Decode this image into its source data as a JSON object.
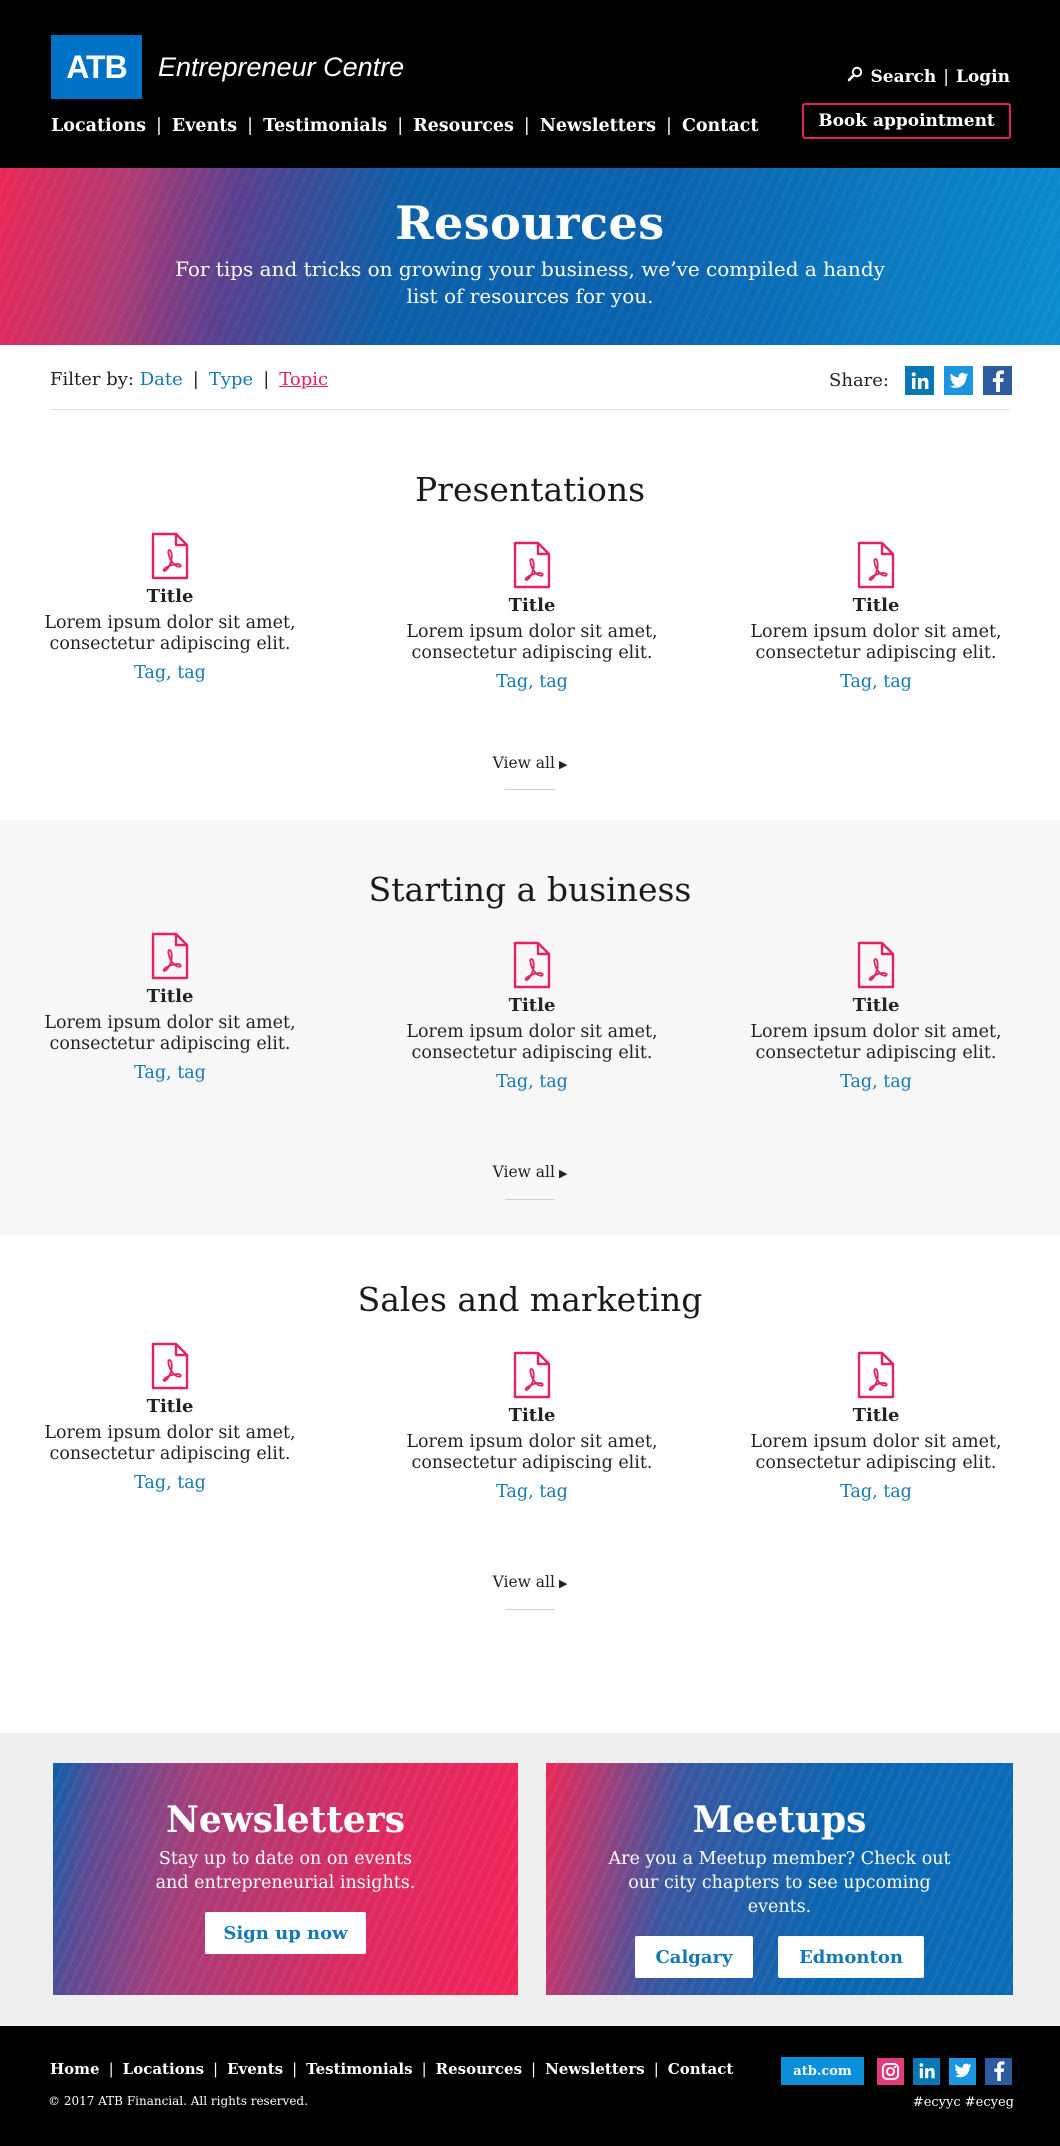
{
  "header": {
    "logo": "ATB",
    "brand": "Entrepreneur Centre",
    "utility": {
      "search": "Search",
      "login": "Login"
    },
    "nav": [
      "Locations",
      "Events",
      "Testimonials",
      "Resources",
      "Newsletters",
      "Contact"
    ],
    "book_button": "Book appointment"
  },
  "hero": {
    "title": "Resources",
    "subtitle": "For tips and tricks on growing your business, we’ve compiled a handy list of resources for you."
  },
  "filter": {
    "label": "Filter by:",
    "options": [
      "Date",
      "Type",
      "Topic"
    ],
    "active": "Topic"
  },
  "share": {
    "label": "Share:",
    "icons": [
      "linkedin-icon",
      "twitter-icon",
      "facebook-icon"
    ]
  },
  "sections": [
    {
      "title": "Presentations",
      "cards": [
        {
          "title": "Title",
          "desc": "Lorem ipsum dolor sit amet, consectetur adipiscing elit.",
          "tag1": "Tag",
          "tag2": "tag"
        },
        {
          "title": "Title",
          "desc": "Lorem ipsum dolor sit amet, consectetur adipiscing elit.",
          "tag1": "Tag",
          "tag2": "tag"
        },
        {
          "title": "Title",
          "desc": "Lorem ipsum dolor sit amet, consectetur adipiscing elit.",
          "tag1": "Tag",
          "tag2": "tag"
        }
      ],
      "view_all": "View all"
    },
    {
      "title": "Starting a business",
      "cards": [
        {
          "title": "Title",
          "desc": "Lorem ipsum dolor sit amet, consectetur adipiscing elit.",
          "tag1": "Tag",
          "tag2": "tag"
        },
        {
          "title": "Title",
          "desc": "Lorem ipsum dolor sit amet, consectetur adipiscing elit.",
          "tag1": "Tag",
          "tag2": "tag"
        },
        {
          "title": "Title",
          "desc": "Lorem ipsum dolor sit amet, consectetur adipiscing elit.",
          "tag1": "Tag",
          "tag2": "tag"
        }
      ],
      "view_all": "View all"
    },
    {
      "title": "Sales and marketing",
      "cards": [
        {
          "title": "Title",
          "desc": "Lorem ipsum dolor sit amet, consectetur adipiscing elit.",
          "tag1": "Tag",
          "tag2": "tag"
        },
        {
          "title": "Title",
          "desc": "Lorem ipsum dolor sit amet, consectetur adipiscing elit.",
          "tag1": "Tag",
          "tag2": "tag"
        },
        {
          "title": "Title",
          "desc": "Lorem ipsum dolor sit amet, consectetur adipiscing elit.",
          "tag1": "Tag",
          "tag2": "tag"
        }
      ],
      "view_all": "View all"
    }
  ],
  "promos": {
    "newsletters": {
      "title": "Newsletters",
      "text": "Stay up to date on on events and entrepreneurial insights.",
      "button": "Sign up now"
    },
    "meetups": {
      "title": "Meetups",
      "text": "Are you a Meetup member? Check out our city chapters to see upcoming events.",
      "buttons": [
        "Calgary",
        "Edmonton"
      ]
    }
  },
  "footer": {
    "nav": [
      "Home",
      "Locations",
      "Events",
      "Testimonials",
      "Resources",
      "Newsletters",
      "Contact"
    ],
    "copyright": "© 2017 ATB Financial. All rights reserved.",
    "site_button": "atb.com",
    "social": [
      "instagram-icon",
      "linkedin-icon",
      "twitter-icon",
      "facebook-icon"
    ],
    "hashtags": "#ecyyc  #ecyeg"
  },
  "colors": {
    "brand_blue": "#0072c6",
    "link_blue": "#1478b3",
    "accent_pink": "#e0245e",
    "header_bg": "#000000",
    "alt_section_bg": "#f7f7f7"
  }
}
